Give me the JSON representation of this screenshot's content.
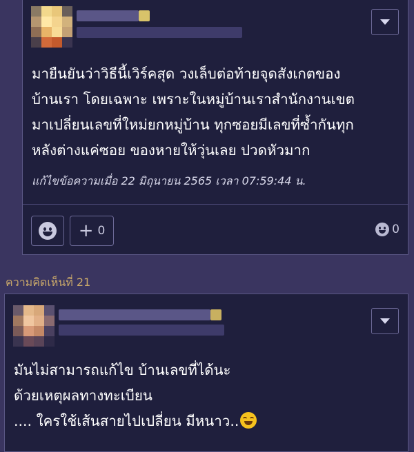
{
  "comment1": {
    "body_lines": [
      "มายืนยันว่าวิธีนี้เวิร์คสุด วงเล็บต่อท้ายจุดสังเกตของ",
      "บ้านเรา โดยเฉพาะ เพราะในหมู่บ้านเราสำนักงานเขต",
      "มาเปลี่ยนเลขที่ใหม่ยกหมู่บ้าน ทุกซอยมีเลขที่ซ้ำกันทุก",
      "หลังต่างแค่ซอย ของหายให้วุ่นเลย ปวดหัวมาก"
    ],
    "edit_note": "แก้ไขข้อความเมื่อ 22 มิถุนายน 2565 เวลา 07:59:44 น.",
    "plus_count": "0",
    "emotion_count": "0"
  },
  "comment2": {
    "label": "ความคิดเห็นที่ 21",
    "body_lines": [
      "มันไม่สามารถแก้ไข บ้านเลขที่ได้นะ",
      "ด้วยเหตุผลทางทะเบียน",
      ".... ใครใช้เส้นสายไปเปลี่ยน มีหนาว.."
    ]
  },
  "icons": {
    "menu": "chevron-down-icon",
    "emotion": "smile-icon",
    "plus": "plus-icon",
    "inline_emoji": "smiling-emoji-icon"
  },
  "colors": {
    "page_bg": "#3a3560",
    "card_bg": "#1f1f3d",
    "label": "#c9a86a"
  }
}
